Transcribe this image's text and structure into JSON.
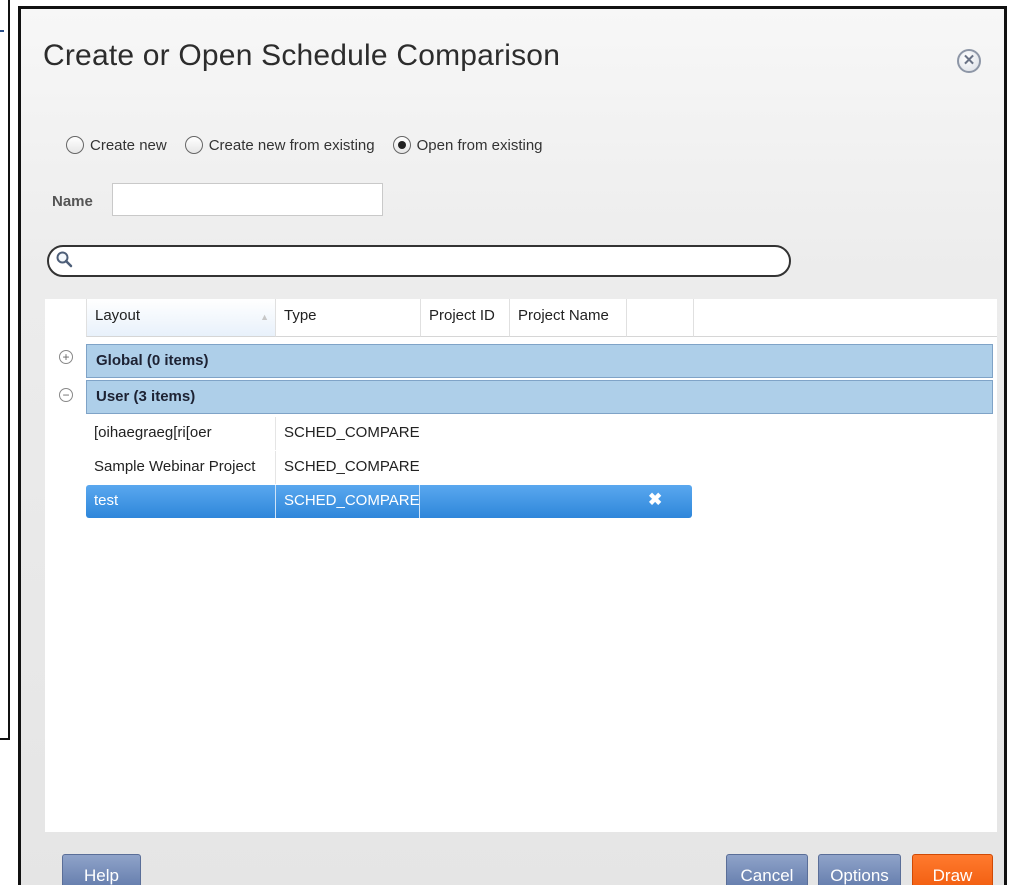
{
  "dialog": {
    "title": "Create or Open Schedule Comparison",
    "close_icon": "close-circle-icon"
  },
  "mode_options": [
    {
      "label": "Create new",
      "selected": false
    },
    {
      "label": "Create new from existing",
      "selected": false
    },
    {
      "label": "Open from existing",
      "selected": true
    }
  ],
  "name_field": {
    "label": "Name",
    "value": ""
  },
  "search": {
    "icon": "search-icon",
    "value": ""
  },
  "grid": {
    "columns": [
      "Layout",
      "Type",
      "Project ID",
      "Project Name"
    ],
    "sorted_column": "Layout",
    "groups": [
      {
        "label": "Global (0 items)",
        "expanded": false,
        "toggle": "+"
      },
      {
        "label": "User (3 items)",
        "expanded": true,
        "toggle": "−"
      }
    ],
    "rows": [
      {
        "layout": "[oihaegraeg[ri[oer",
        "type": "SCHED_COMPARE"
      },
      {
        "layout": "Sample Webinar Project",
        "type": "SCHED_COMPARE"
      },
      {
        "layout": "test",
        "type": "SCHED_COMPARE",
        "selected": true,
        "delete_icon": "✖"
      }
    ]
  },
  "buttons": {
    "help": "Help",
    "cancel": "Cancel",
    "options": "Options",
    "draw": "Draw"
  },
  "colors": {
    "group_bg": "#aecfe9",
    "selected_row": "#3a8fe0",
    "draw_button": "#f26a1b",
    "secondary_button": "#7189b9"
  }
}
